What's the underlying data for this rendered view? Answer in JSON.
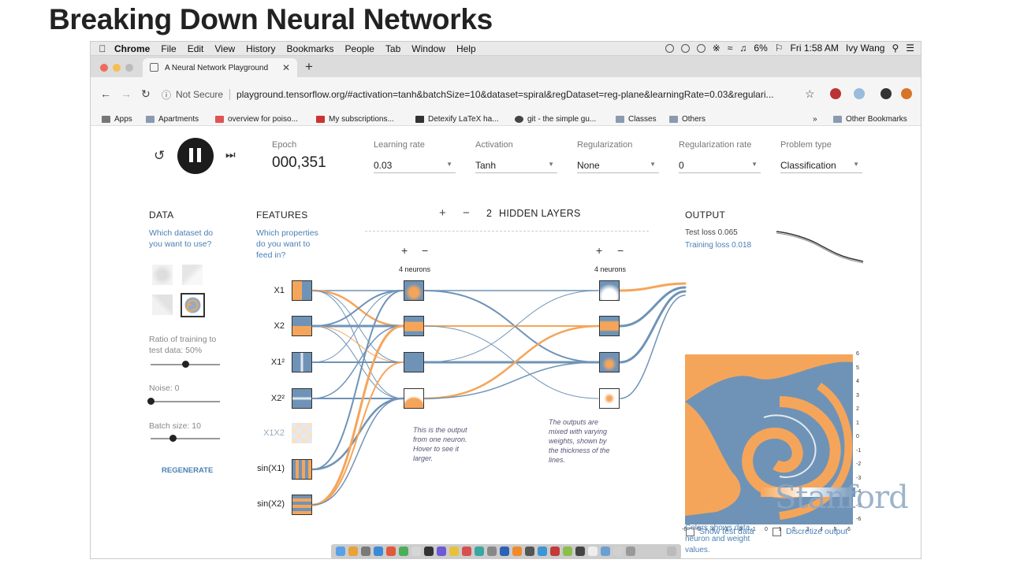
{
  "slide": {
    "title": "Breaking Down Neural Networks"
  },
  "menubar": {
    "items": [
      "Chrome",
      "File",
      "Edit",
      "View",
      "History",
      "Bookmarks",
      "People",
      "Tab",
      "Window",
      "Help"
    ],
    "battery": "6%",
    "clock": "Fri 1:58 AM",
    "user": "Ivy Wang"
  },
  "tab": {
    "title": "A Neural Network Playground"
  },
  "address": {
    "security": "Not Secure",
    "url": "playground.tensorflow.org/#activation=tanh&batchSize=10&dataset=spiral&regDataset=reg-plane&learningRate=0.03&regulari..."
  },
  "bookmarks": [
    "Apps",
    "Apartments",
    "overview for poiso...",
    "My subscriptions...",
    "Detexify LaTeX ha...",
    "git - the simple gu...",
    "Classes",
    "Others",
    "Other Bookmarks"
  ],
  "controls": {
    "epoch_label": "Epoch",
    "epoch": "000,351",
    "lr_label": "Learning rate",
    "lr": "0.03",
    "act_label": "Activation",
    "act": "Tanh",
    "reg_label": "Regularization",
    "reg": "None",
    "regrate_label": "Regularization rate",
    "regrate": "0",
    "ptype_label": "Problem type",
    "ptype": "Classification"
  },
  "data_panel": {
    "heading": "DATA",
    "question": "Which dataset do you want to use?",
    "ratio": "Ratio of training to test data:  50%",
    "noise": "Noise:  0",
    "batch": "Batch size:  10",
    "regenerate": "REGENERATE"
  },
  "features": {
    "heading": "FEATURES",
    "question": "Which properties do you want to feed in?",
    "items": [
      "X1",
      "X2",
      "X1²",
      "X2²",
      "X1X2",
      "sin(X1)",
      "sin(X2)"
    ]
  },
  "hidden": {
    "plus": "+",
    "minus": "−",
    "count": "2",
    "label": "HIDDEN LAYERS",
    "layer1": "4 neurons",
    "layer2": "4 neurons",
    "note1": "This is the output from one neuron. Hover to see it larger.",
    "note2": "The outputs are mixed with varying weights, shown by the thickness of the lines."
  },
  "output": {
    "heading": "OUTPUT",
    "test_loss": "Test loss 0.065",
    "train_loss": "Training loss 0.018",
    "yticks": [
      "6",
      "5",
      "4",
      "3",
      "2",
      "1",
      "0",
      "-1",
      "-2",
      "-3",
      "-4",
      "-5",
      "-6"
    ],
    "xticks": [
      "-6",
      "-5",
      "-4",
      "-3",
      "-2",
      "-1",
      "0",
      "1",
      "2",
      "3",
      "4",
      "5",
      "6"
    ],
    "legend": "Colors shows data, neuron and weight values.",
    "show_test": "Show test data",
    "discretize": "Discretize output",
    "watermark": "Stanford"
  },
  "colors": {
    "orange": "#f5a55a",
    "blue": "#6f93b7"
  }
}
